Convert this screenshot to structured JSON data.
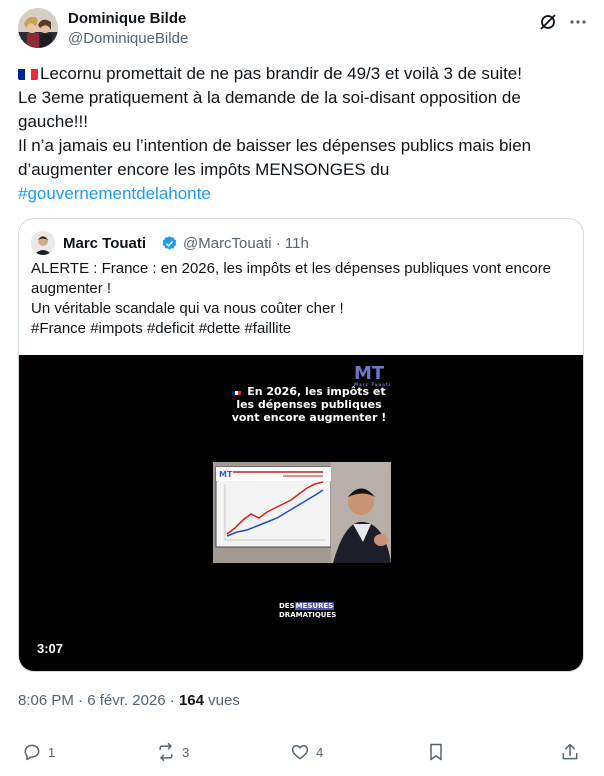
{
  "post": {
    "author_name": "Dominique Bilde",
    "author_handle": "@DominiqueBilde",
    "text_lines": [
      "Lecornu promettait de ne pas brandir de 49/3 et voilà 3 de suite!",
      "Le 3eme pratiquement à la demande de la soi-disant opposition de",
      "gauche!!!",
      "Il n’a jamais eu l’intention de baisser les dépenses publics mais bien",
      "d’augmenter encore les impôts MENSONGES du"
    ],
    "hashtag": "#gouvernementdelahonte",
    "time": "8:06 PM",
    "separator": " · ",
    "date": "6 févr. 2026",
    "views_count": "164",
    "views_label": "vues"
  },
  "quote": {
    "author_name": "Marc Touati",
    "author_handle": "@MarcTouati · 11h",
    "text_lines": [
      "ALERTE : France : en 2026, les impôts et les dépenses publiques vont encore",
      "augmenter !",
      "Un véritable scandale qui va nous coûter cher !",
      "#France #impots #deficit #dette #faillite"
    ],
    "video": {
      "logo": "MT",
      "logo_sub": "Marc Touati",
      "caption_lines": [
        "En 2026, les impôts et",
        "les dépenses publiques",
        "vont encore augmenter !"
      ],
      "brand_line1_a": "DES",
      "brand_line1_b": "MESURES",
      "brand_line2": "DRAMATIQUES",
      "duration": "3:07"
    }
  },
  "actions": {
    "replies": "1",
    "reposts": "3",
    "likes": "4"
  },
  "icons": {
    "grok": "grok-icon",
    "more": "more-icon",
    "verified": "verified-badge-icon",
    "reply": "reply-icon",
    "repost": "repost-icon",
    "like": "heart-icon",
    "bookmark": "bookmark-icon",
    "share": "share-icon"
  },
  "colors": {
    "accent": "#1d9bf0",
    "secondary_text": "#536471",
    "border": "#cfd9de"
  }
}
